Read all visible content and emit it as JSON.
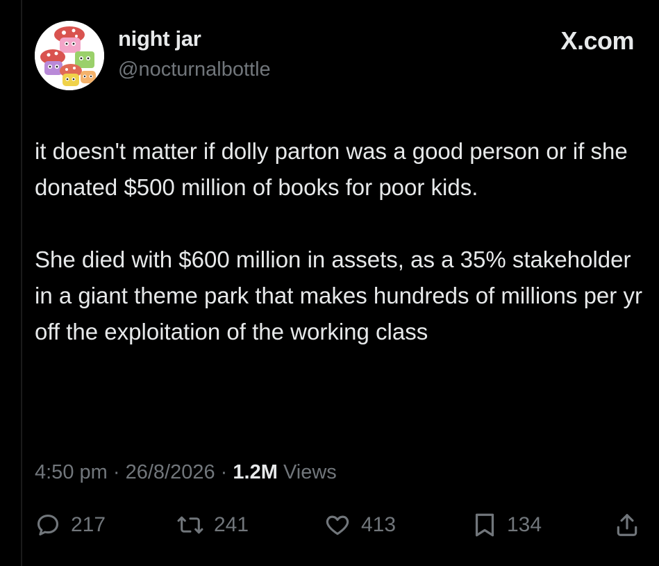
{
  "author": {
    "display_name": "night jar",
    "handle": "@nocturnalbottle",
    "avatar_icon": "mushroom-avatar-icon"
  },
  "brand": {
    "label": "X.com"
  },
  "tweet": {
    "paragraphs": [
      "it doesn't matter if dolly parton was a good person or if she donated $500 million of books for poor kids.",
      "She died with $600 million in assets, as a 35% stakeholder in a giant theme park that makes hundreds of millions per yr off the exploitation of the working class"
    ],
    "time": "4:50 pm",
    "separator": "·",
    "date": "26/8/2026",
    "views_count": "1.2M",
    "views_label": "Views"
  },
  "actions": {
    "replies": "217",
    "reposts": "241",
    "likes": "413",
    "bookmarks": "134"
  },
  "colors": {
    "background": "#000000",
    "text_primary": "#e7e9ea",
    "text_secondary": "#71767b"
  }
}
